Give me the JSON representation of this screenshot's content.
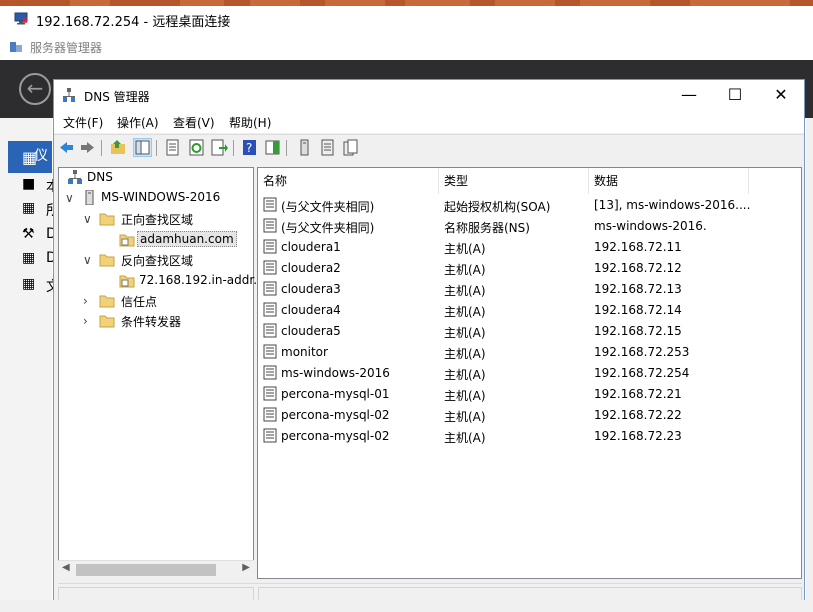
{
  "rdp_window": {
    "title": "192.168.72.254 - 远程桌面连接"
  },
  "server_manager": {
    "title": "服务器管理器",
    "sidebar": [
      {
        "label": "仪"
      },
      {
        "label": "本"
      },
      {
        "label": "所"
      },
      {
        "label": "D"
      },
      {
        "label": "D"
      },
      {
        "label": "文"
      }
    ]
  },
  "dns_window": {
    "title": "DNS 管理器",
    "controls": {
      "minimize": "—",
      "maximize": "☐",
      "close": "✕"
    },
    "menu": [
      {
        "label": "文件(F)"
      },
      {
        "label": "操作(A)"
      },
      {
        "label": "查看(V)"
      },
      {
        "label": "帮助(H)"
      }
    ],
    "toolbar": [
      "back-icon",
      "forward-icon",
      "up-folder-icon",
      "show-hide-tree-icon",
      "properties-icon",
      "refresh-icon",
      "export-icon",
      "help-icon",
      "show-pane-icon",
      "server-icon",
      "list-icon",
      "copy-icon"
    ],
    "tree": {
      "root": "DNS",
      "server": "MS-WINDOWS-2016",
      "forward_zones": "正向查找区域",
      "forward_zone_selected": "adamhuan.com",
      "reverse_zones": "反向查找区域",
      "reverse_zone": "72.168.192.in-addr.",
      "trust_points": "信任点",
      "conditional_forwarders": "条件转发器"
    },
    "columns": {
      "name": "名称",
      "type": "类型",
      "data": "数据"
    },
    "records": [
      {
        "name": "(与父文件夹相同)",
        "type": "起始授权机构(SOA)",
        "data": "[13], ms-windows-2016...."
      },
      {
        "name": "(与父文件夹相同)",
        "type": "名称服务器(NS)",
        "data": "ms-windows-2016."
      },
      {
        "name": "cloudera1",
        "type": "主机(A)",
        "data": "192.168.72.11"
      },
      {
        "name": "cloudera2",
        "type": "主机(A)",
        "data": "192.168.72.12"
      },
      {
        "name": "cloudera3",
        "type": "主机(A)",
        "data": "192.168.72.13"
      },
      {
        "name": "cloudera4",
        "type": "主机(A)",
        "data": "192.168.72.14"
      },
      {
        "name": "cloudera5",
        "type": "主机(A)",
        "data": "192.168.72.15"
      },
      {
        "name": "monitor",
        "type": "主机(A)",
        "data": "192.168.72.253"
      },
      {
        "name": "ms-windows-2016",
        "type": "主机(A)",
        "data": "192.168.72.254"
      },
      {
        "name": "percona-mysql-01",
        "type": "主机(A)",
        "data": "192.168.72.21"
      },
      {
        "name": "percona-mysql-02",
        "type": "主机(A)",
        "data": "192.168.72.22"
      },
      {
        "name": "percona-mysql-02",
        "type": "主机(A)",
        "data": "192.168.72.23"
      }
    ]
  }
}
